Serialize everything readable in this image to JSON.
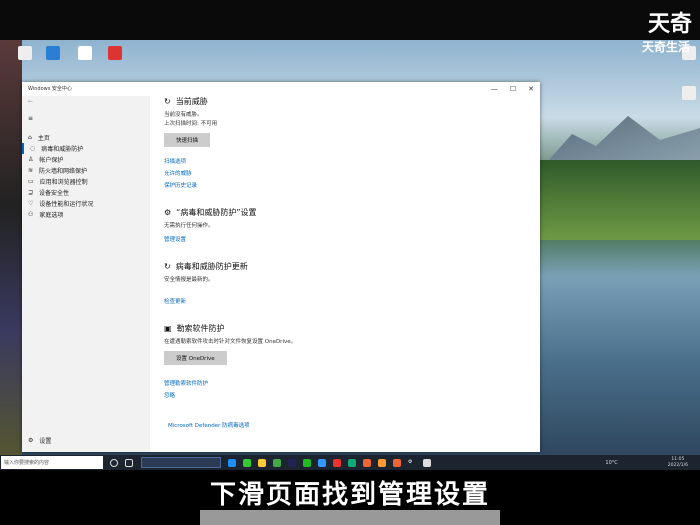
{
  "brand": {
    "logo": "天奇",
    "sub": "天奇生活"
  },
  "window": {
    "title": "Windows 安全中心",
    "controls": [
      "—",
      "☐",
      "✕"
    ]
  },
  "sidebar": {
    "items": [
      {
        "label": "主页",
        "icon": "home-icon"
      },
      {
        "label": "病毒和威胁防护",
        "icon": "shield-icon",
        "selected": true
      },
      {
        "label": "帐户保护",
        "icon": "person-icon"
      },
      {
        "label": "防火墙和网络保护",
        "icon": "wifi-icon"
      },
      {
        "label": "应用和浏览器控制",
        "icon": "window-icon"
      },
      {
        "label": "设备安全性",
        "icon": "laptop-icon"
      },
      {
        "label": "设备性能和运行状况",
        "icon": "heart-icon"
      },
      {
        "label": "家庭选项",
        "icon": "family-icon"
      }
    ],
    "settings": "设置"
  },
  "main": {
    "threats": {
      "title": "当前威胁",
      "line1": "当前没有威胁。",
      "line2": "上次扫描时间: 不可用",
      "button": "快速扫描",
      "links": [
        "扫描选项",
        "允许的威胁",
        "保护历史记录"
      ]
    },
    "settings": {
      "title": "“病毒和威胁防护”设置",
      "desc": "无需执行任何操作。",
      "link": "管理设置"
    },
    "updates": {
      "title": "病毒和威胁防护更新",
      "desc": "安全情报是最新的。",
      "link": "检查更新"
    },
    "ransom": {
      "title": "勒索软件防护",
      "desc": "在遭遇勒索软件攻击时针对文件恢复设置 OneDrive。",
      "button": "设置 OneDrive",
      "links": [
        "管理勒索软件防护",
        "忽略"
      ]
    },
    "footer_link": "Microsoft Defender 防病毒选项"
  },
  "taskbar": {
    "search_placeholder": "输入你要搜索的内容",
    "weather": "10°C",
    "time": "11:05",
    "date": "2022/1/6"
  },
  "caption": "下滑页面找到管理设置"
}
